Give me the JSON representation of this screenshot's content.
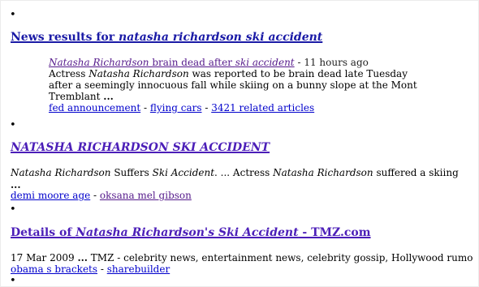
{
  "news": {
    "heading_prefix": "News results for ",
    "heading_query": "natasha richardson ski accident",
    "item": {
      "title_part1": "Natasha Richardson",
      "title_part2": " brain dead after ",
      "title_part3": "ski accident",
      "age": " - 11 hours ago",
      "snippet_line1_a": "Actress ",
      "snippet_line1_b": "Natasha Richardson",
      "snippet_line1_c": " was reported to be brain dead late Tuesday",
      "snippet_line2": "after a seemingly innocuous fall while skiing on a bunny slope at the Mont",
      "snippet_line3_a": "Tremblant ",
      "snippet_line3_b": "...",
      "links": [
        "fed announcement",
        "flying cars",
        "3421 related articles"
      ],
      "sep": " - "
    }
  },
  "result1": {
    "title": "NATASHA RICHARDSON SKI ACCIDENT",
    "snip_a": "Natasha Richardson",
    "snip_b": " Suffers ",
    "snip_c": "Ski Accident",
    "snip_d": ". ... Actress ",
    "snip_e": "Natasha Richardson",
    "snip_f": " suffered a skiing",
    "ellipsis": "...",
    "links": [
      "demi moore age",
      "oksana mel gibson"
    ],
    "sep": " - "
  },
  "result2": {
    "title_a": "Details of ",
    "title_b": "Natasha Richardson's Ski Accident",
    "title_c": " - TMZ.com",
    "date": "17 Mar 2009 ",
    "ellipsis": "...",
    "snip": " TMZ - celebrity news, entertainment news, celebrity gossip, Hollywood rumo",
    "links": [
      "obama s brackets",
      "sharebuilder"
    ],
    "sep": " - "
  },
  "bullet": "•"
}
